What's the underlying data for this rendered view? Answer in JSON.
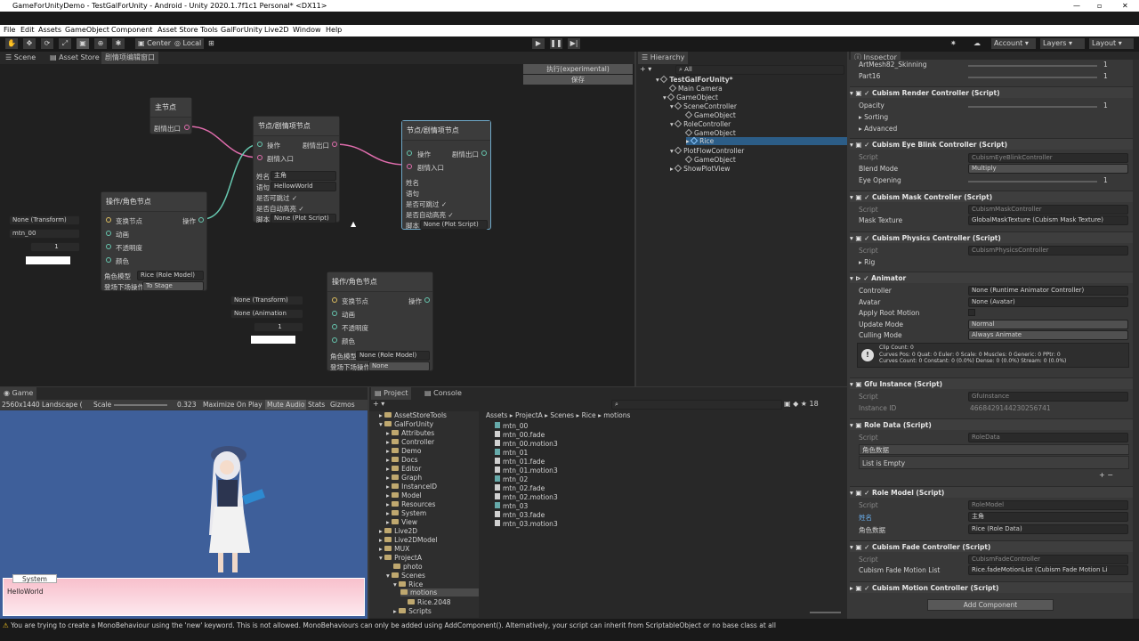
{
  "window": {
    "title": "GameForUnityDemo - TestGalForUnity - Android - Unity 2020.1.7f1c1 Personal* <DX11>"
  },
  "menu": [
    "File",
    "Edit",
    "Assets",
    "GameObject",
    "Component",
    "Asset Store Tools",
    "GalForUnity",
    "Live2D",
    "Window",
    "Help"
  ],
  "toolbar": {
    "center": "Center",
    "local": "Local",
    "account": "Account",
    "layers": "Layers",
    "layout": "Layout"
  },
  "scene_tabs": [
    "Scene",
    "Asset Store",
    "剧情项编辑窗口"
  ],
  "graph": {
    "run_button": "执行(experimental)",
    "save_button": "保存",
    "main_node": {
      "title": "主节点",
      "out": "剧情出口"
    },
    "plot_node1": {
      "title": "节点/剧情项节点",
      "op": "操作",
      "in": "剧情入口",
      "out": "剧情出口",
      "name_label": "姓名",
      "name_val": "主角",
      "speech_label": "语句",
      "speech_val": "HellowWorld",
      "skip": "是否可跳过",
      "hl": "是否自动高亮",
      "script_label": "脚本",
      "script_val": "None (Plot Script)"
    },
    "plot_node2": {
      "title": "节点/剧情项节点",
      "op": "操作",
      "in": "剧情入口",
      "out": "剧情出口",
      "name_label": "姓名",
      "speech_label": "语句",
      "skip": "是否可跳过",
      "hl": "是否自动高亮",
      "script_label": "脚本",
      "script_val": "None (Plot Script)"
    },
    "role_node1": {
      "title": "操作/角色节点",
      "op": "操作",
      "t": "变换节点",
      "a": "动画",
      "o": "不透明度",
      "c": "颜色",
      "f_t": "None (Transform)",
      "f_a": "mtn_00",
      "f_o": "1",
      "model_label": "角色模型",
      "model_val": "Rice (Role Model)",
      "stage_label": "登场下场操作",
      "stage_val": "To Stage"
    },
    "role_node2": {
      "title": "操作/角色节点",
      "op": "操作",
      "t": "变换节点",
      "a": "动画",
      "o": "不透明度",
      "c": "颜色",
      "f_t": "None (Transform)",
      "f_a": "None (Animation",
      "f_o": "1",
      "model_label": "角色模型",
      "model_val": "None (Role Model)",
      "stage_label": "登场下场操作",
      "stage_val": "None"
    }
  },
  "hierarchy": {
    "tab": "Hierarchy",
    "search": "All",
    "items": [
      "TestGalForUnity*",
      "Main Camera",
      "GameObject",
      "SceneController",
      "GameObject",
      "RoleController",
      "GameObject",
      "Rice",
      "PlotFlowController",
      "GameObject",
      "ShowPlotView"
    ]
  },
  "game": {
    "tab": "Game",
    "res": "2560x1440 Landscape (",
    "scale_label": "Scale",
    "scale_val": "0.323",
    "maximize": "Maximize On Play",
    "mute": "Mute Audio",
    "stats": "Stats",
    "gizmos": "Gizmos",
    "speaker": "System",
    "dialog": "HelloWorld"
  },
  "project": {
    "tabs": [
      "Project",
      "Console"
    ],
    "count": "18",
    "breadcrumb": [
      "Assets",
      "ProjectA",
      "Scenes",
      "Rice",
      "motions"
    ],
    "tree": [
      "AssetStoreTools",
      "GalForUnity",
      "Attributes",
      "Controller",
      "Demo",
      "Docs",
      "Editor",
      "Graph",
      "InstanceID",
      "Model",
      "Resources",
      "System",
      "View",
      "Live2D",
      "Live2DModel",
      "MUX",
      "ProjectA",
      "photo",
      "Scenes",
      "Rice",
      "motions",
      "Rice.2048",
      "Scripts"
    ],
    "files": [
      "mtn_00",
      "mtn_00.fade",
      "mtn_00.motion3",
      "mtn_01",
      "mtn_01.fade",
      "mtn_01.motion3",
      "mtn_02",
      "mtn_02.fade",
      "mtn_02.motion3",
      "mtn_03",
      "mtn_03.fade",
      "mtn_03.motion3"
    ]
  },
  "inspector": {
    "tab": "Inspector",
    "rows": {
      "r1": "ArtMesh82_Skinning",
      "r1v": "1",
      "r2": "Part16",
      "r2v": "1",
      "render": "Cubism Render Controller (Script)",
      "opacity": "Opacity",
      "opacity_v": "1",
      "sorting": "Sorting",
      "advanced": "Advanced",
      "blink": "Cubism Eye Blink Controller (Script)",
      "script": "Script",
      "blink_s": "CubismEyeBlinkController",
      "blend": "Blend Mode",
      "blend_v": "Multiply",
      "eye": "Eye Opening",
      "eye_v": "1",
      "mask": "Cubism Mask Controller (Script)",
      "mask_s": "CubismMaskController",
      "masktex": "Mask Texture",
      "masktex_v": "GlobalMaskTexture (Cubism Mask Texture)",
      "phys": "Cubism Physics Controller (Script)",
      "phys_s": "CubismPhysicsController",
      "rig": "Rig",
      "anim": "Animator",
      "controller": "Controller",
      "controller_v": "None (Runtime Animator Controller)",
      "avatar": "Avatar",
      "avatar_v": "None (Avatar)",
      "root": "Apply Root Motion",
      "update": "Update Mode",
      "update_v": "Normal",
      "cull": "Culling Mode",
      "cull_v": "Always Animate",
      "clip1": "Clip Count: 0",
      "clip2": "Curves Pos: 0 Quat: 0 Euler: 0 Scale: 0 Muscles: 0 Generic: 0 PPtr: 0",
      "clip3": "Curves Count: 0 Constant: 0 (0.0%) Dense: 0 (0.0%) Stream: 0 (0.0%)",
      "gfu": "Gfu Instance (Script)",
      "gfu_s": "GfuInstance",
      "iid": "Instance ID",
      "iid_v": "4668429144230256741",
      "rdata": "Role Data (Script)",
      "rdata_s": "RoleData",
      "rdata_l": "角色数据",
      "empty": "List is Empty",
      "rmodel": "Role Model (Script)",
      "rmodel_s": "RoleModel",
      "name": "姓名",
      "name_v": "主角",
      "rd": "角色数据",
      "rd_v": "Rice (Role Data)",
      "fade": "Cubism Fade Controller (Script)",
      "fade_s": "CubismFadeController",
      "fml": "Cubism Fade Motion List",
      "fml_v": "Rice.fadeMotionList (Cubism Fade Motion Li",
      "motion": "Cubism Motion Controller (Script)",
      "add": "Add Component"
    }
  },
  "status": "You are trying to create a MonoBehaviour using the 'new' keyword.  This is not allowed.  MonoBehaviours can only be added using AddComponent(). Alternatively, your script can inherit from ScriptableObject or no base class at all"
}
